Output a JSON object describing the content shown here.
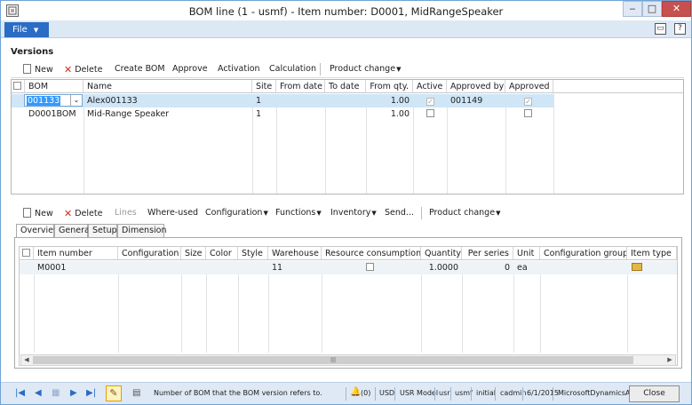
{
  "window": {
    "title": "BOM line (1 - usmf) - Item number: D0001, MidRangeSpeaker",
    "minimize": "‒",
    "maximize": "□",
    "close": "✕"
  },
  "menu": {
    "file": "File"
  },
  "versions": {
    "title": "Versions",
    "toolbar": {
      "new": "New",
      "delete": "Delete",
      "create_bom": "Create BOM",
      "approve": "Approve",
      "activation": "Activation",
      "calculation": "Calculation",
      "product_change": "Product change"
    },
    "columns": [
      "BOM",
      "Name",
      "Site",
      "From date",
      "To date",
      "From qty.",
      "Active",
      "Approved by",
      "Approved"
    ],
    "rows": [
      {
        "bom": "001133",
        "name": "Alex001133",
        "site": "1",
        "from_date": "",
        "to_date": "",
        "from_qty": "1.00",
        "active": true,
        "approved_by": "001149",
        "approved": true
      },
      {
        "bom": "D0001BOM",
        "name": "Mid-Range Speaker",
        "site": "1",
        "from_date": "",
        "to_date": "",
        "from_qty": "1.00",
        "active": false,
        "approved_by": "",
        "approved": false
      }
    ]
  },
  "lines": {
    "toolbar": {
      "new": "New",
      "delete": "Delete",
      "lines": "Lines",
      "where_used": "Where-used",
      "configuration": "Configuration",
      "functions": "Functions",
      "inventory": "Inventory",
      "send": "Send...",
      "product_change": "Product change"
    },
    "tabs": [
      "Overview",
      "General",
      "Setup",
      "Dimension"
    ],
    "columns": [
      "Item number",
      "Configuration",
      "Size",
      "Color",
      "Style",
      "Warehouse",
      "Resource consumption",
      "Quantity",
      "Per series",
      "Unit",
      "Configuration group",
      "Item type"
    ],
    "rows": [
      {
        "item_number": "M0001",
        "configuration": "",
        "size": "",
        "color": "",
        "style": "",
        "warehouse": "11",
        "resource_consumption": false,
        "quantity": "1.0000",
        "per_series": "0",
        "unit": "ea",
        "configuration_group": "",
        "item_type_icon": "item-type-icon"
      }
    ]
  },
  "status": {
    "message": "Number of BOM that the BOM version refers to.",
    "notifications": "(0)",
    "currency": "USD",
    "model": "USR Model",
    "layer": "usr",
    "company": "usmf",
    "partition": "initial",
    "user": "cadmin",
    "date": "6/1/2015",
    "product": "MicrosoftDynamicsAX",
    "close": "Close"
  },
  "colors": {
    "accent": "#2b6cc4",
    "selected_row": "#cfe6f7",
    "delete": "#d02b20"
  }
}
